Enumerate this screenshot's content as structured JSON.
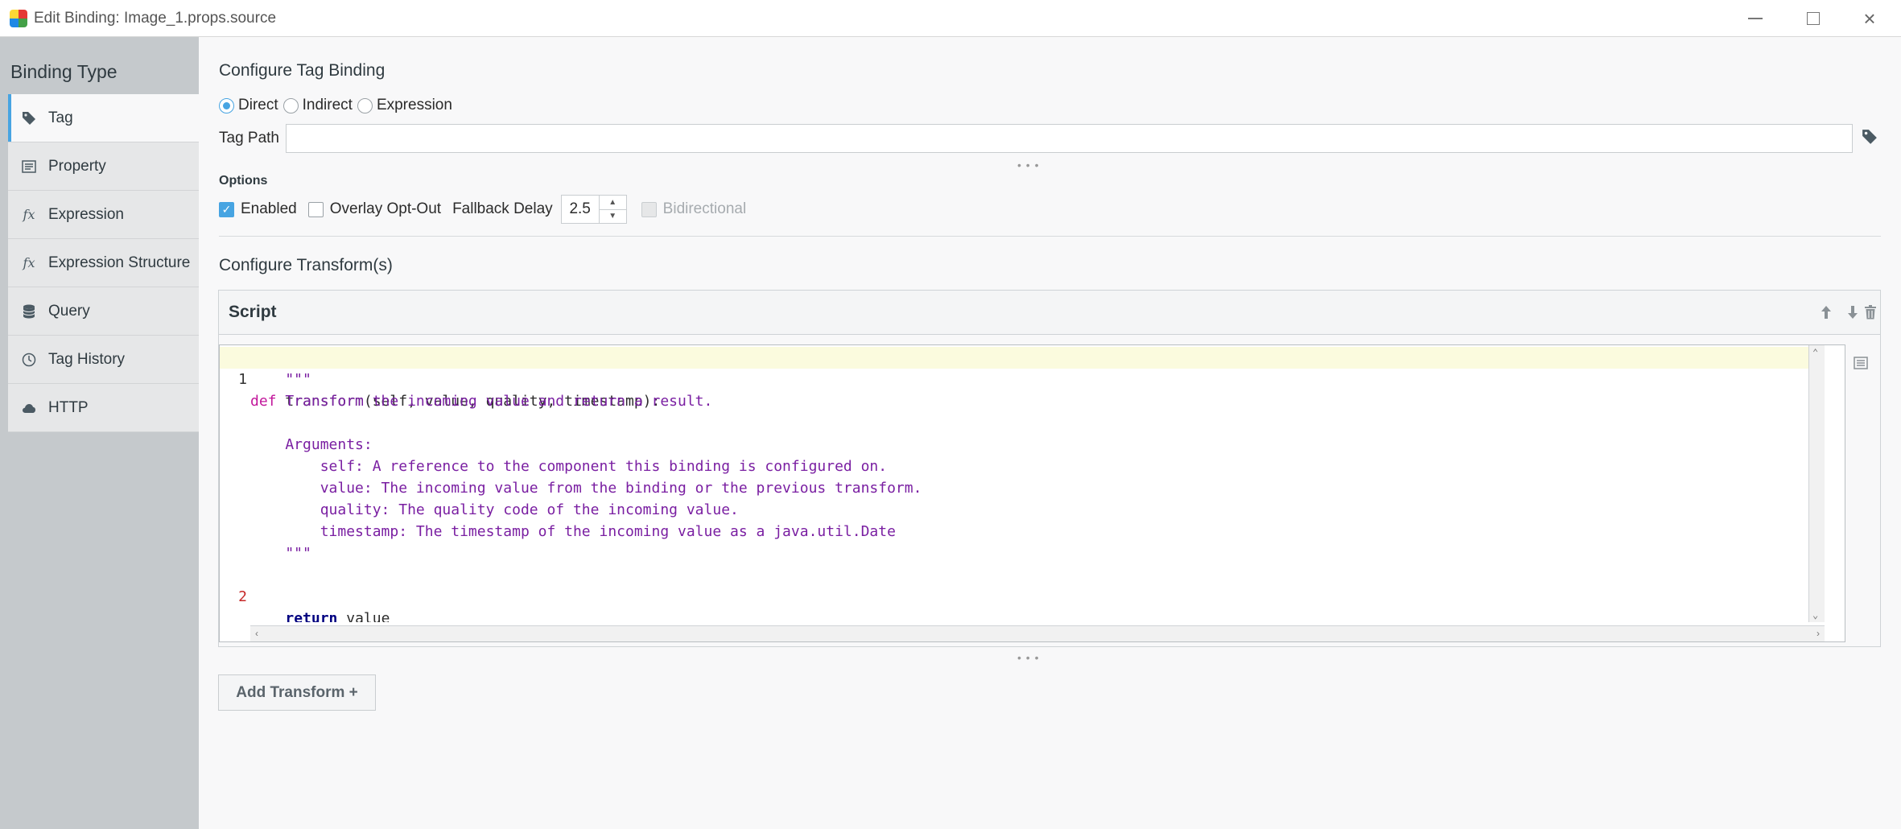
{
  "window": {
    "title": "Edit Binding: Image_1.props.source"
  },
  "sidebar": {
    "title": "Binding Type",
    "items": [
      {
        "label": "Tag",
        "icon": "tag-icon",
        "active": true
      },
      {
        "label": "Property",
        "icon": "property-icon",
        "active": false
      },
      {
        "label": "Expression",
        "icon": "fx-icon",
        "active": false
      },
      {
        "label": "Expression Structure",
        "icon": "fx-icon",
        "active": false
      },
      {
        "label": "Query",
        "icon": "database-icon",
        "active": false
      },
      {
        "label": "Tag History",
        "icon": "clock-icon",
        "active": false
      },
      {
        "label": "HTTP",
        "icon": "cloud-icon",
        "active": false
      }
    ]
  },
  "tag_binding": {
    "heading": "Configure Tag Binding",
    "modes": [
      {
        "label": "Direct",
        "selected": true
      },
      {
        "label": "Indirect",
        "selected": false
      },
      {
        "label": "Expression",
        "selected": false
      }
    ],
    "tag_path_label": "Tag Path",
    "tag_path_value": ""
  },
  "options": {
    "label": "Options",
    "enabled_label": "Enabled",
    "enabled_checked": true,
    "overlay_label": "Overlay Opt-Out",
    "overlay_checked": false,
    "fallback_label": "Fallback Delay",
    "fallback_value": "2.5",
    "bidirectional_label": "Bidirectional",
    "bidirectional_checked": false
  },
  "transforms": {
    "heading": "Configure Transform(s)",
    "panel_title": "Script",
    "code": {
      "line1_num": "1",
      "line1_kw": "def",
      "line1_rest": " transform(self, value, quality, timestamp):",
      "doc_open": "    \"\"\"",
      "doc_1": "    Transform the incoming value and return a result.",
      "doc_blank": "",
      "doc_args": "    Arguments:",
      "doc_self": "        self: A reference to the component this binding is configured on.",
      "doc_value": "        value: The incoming value from the binding or the previous transform.",
      "doc_quality": "        quality: The quality code of the incoming value.",
      "doc_timestamp": "        timestamp: The timestamp of the incoming value as a java.util.Date",
      "doc_close": "    \"\"\"",
      "line2_num": "2",
      "line2_kw": "return",
      "line2_rest": " value"
    },
    "add_button_label": "Add Transform +"
  }
}
